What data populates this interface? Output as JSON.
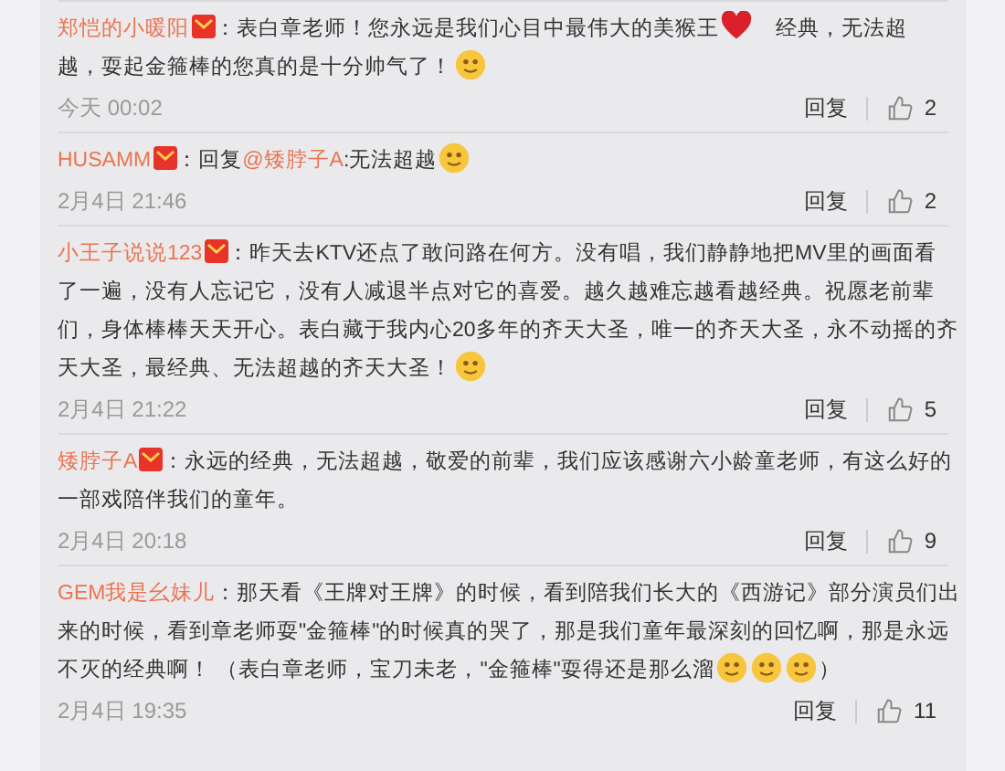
{
  "comments": [
    {
      "author": "郑恺的小暖阳",
      "badge": true,
      "lines": [
        [
          {
            "kind": "text",
            "text": "：表白章老师！您永远是我们心目中最伟大的美猴王"
          },
          {
            "kind": "heart"
          },
          {
            "kind": "text",
            "text": "    经典，无法超"
          }
        ],
        [
          {
            "kind": "text",
            "text": "越，耍起金箍棒的您真的是十分帅气了！"
          },
          {
            "kind": "emoji"
          }
        ]
      ],
      "time": "今天 00:02",
      "reply": "回复",
      "likes": "2"
    },
    {
      "author": "HUSAMM",
      "badge": true,
      "lines": [
        [
          {
            "kind": "text",
            "text": "：回复"
          },
          {
            "kind": "link",
            "text": "@矮脖子A"
          },
          {
            "kind": "text",
            "text": ":无法超越"
          },
          {
            "kind": "emoji"
          }
        ]
      ],
      "time": "2月4日 21:46",
      "reply": "回复",
      "likes": "2"
    },
    {
      "author": "小王子说说123",
      "badge": true,
      "lines": [
        [
          {
            "kind": "text",
            "text": "：昨天去KTV还点了敢问路在何方。没有唱，我们静静地把MV里的画面看"
          }
        ],
        [
          {
            "kind": "text",
            "text": "了一遍，没有人忘记它，没有人减退半点对它的喜爱。越久越难忘越看越经典。祝愿老前辈"
          }
        ],
        [
          {
            "kind": "text",
            "text": "们，身体棒棒天天开心。表白藏于我内心20多年的齐天大圣，唯一的齐天大圣，永不动摇的齐"
          }
        ],
        [
          {
            "kind": "text",
            "text": "天大圣，最经典、无法超越的齐天大圣！"
          },
          {
            "kind": "emoji"
          }
        ]
      ],
      "time": "2月4日 21:22",
      "reply": "回复",
      "likes": "5"
    },
    {
      "author": "矮脖子A",
      "badge": true,
      "lines": [
        [
          {
            "kind": "text",
            "text": "：永远的经典，无法超越，敬爱的前辈，我们应该感谢六小龄童老师，有这么好的"
          }
        ],
        [
          {
            "kind": "text",
            "text": "一部戏陪伴我们的童年。"
          }
        ]
      ],
      "time": "2月4日 20:18",
      "reply": "回复",
      "likes": "9"
    },
    {
      "author": "GEM我是幺妹儿",
      "badge": false,
      "lines": [
        [
          {
            "kind": "text",
            "text": "：那天看《王牌对王牌》的时候，看到陪我们长大的《西游记》部分演员们出"
          }
        ],
        [
          {
            "kind": "text",
            "text": "来的时候，看到章老师耍\"金箍棒\"的时候真的哭了，那是我们童年最深刻的回忆啊，那是永远"
          }
        ],
        [
          {
            "kind": "text",
            "text": "不灭的经典啊！ （表白章老师，宝刀未老，\"金箍棒\"耍得还是那么溜"
          },
          {
            "kind": "emoji"
          },
          {
            "kind": "emoji"
          },
          {
            "kind": "emoji"
          },
          {
            "kind": "text",
            "text": "）"
          }
        ]
      ],
      "time": "2月4日 19:35",
      "reply": "回复",
      "likes": "11"
    }
  ]
}
